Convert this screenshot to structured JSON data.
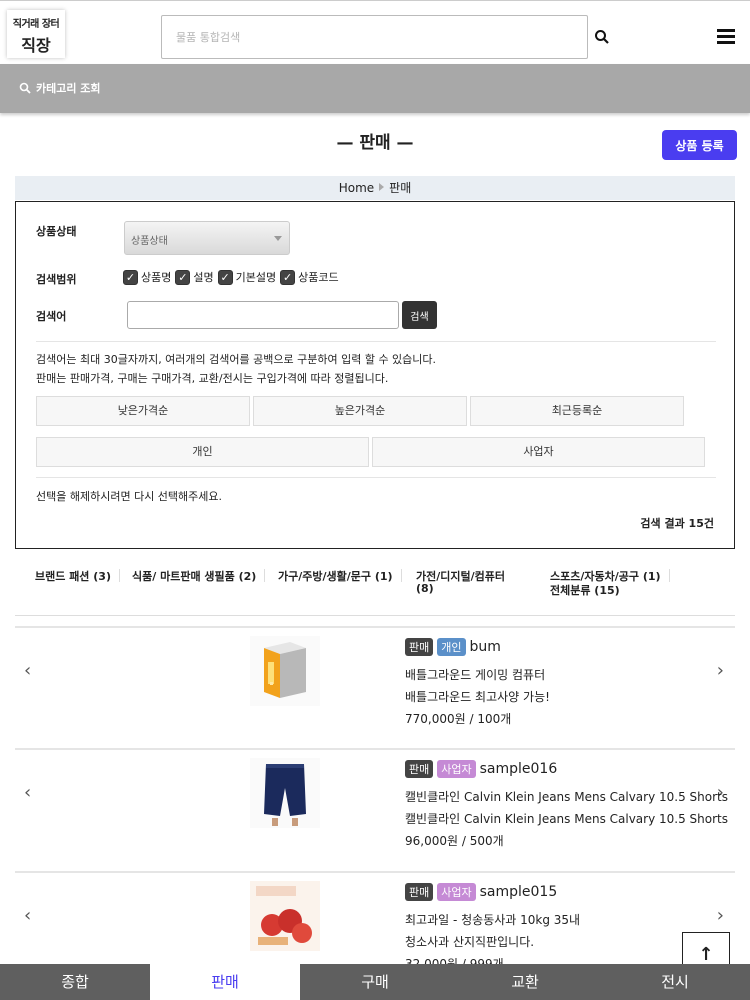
{
  "header": {
    "logo_line1": "직거래 장터",
    "logo_line2": "직장",
    "search_placeholder": "물품 통합검색"
  },
  "category_bar": {
    "label": "카테고리 조회"
  },
  "page_title": "— 판매 —",
  "register_button": "상품 등록",
  "breadcrumb": {
    "home": "Home",
    "current": "판매"
  },
  "filter": {
    "status_label": "상품상태",
    "status_select": "상품상태",
    "scope_label": "검색범위",
    "scope_options": [
      "상품명",
      "설명",
      "기본설명",
      "상품코드"
    ],
    "keyword_label": "검색어",
    "search_button": "검색",
    "note1": "검색어는 최대 30글자까지, 여러개의 검색어를 공백으로 구분하여 입력 할 수 있습니다.",
    "note2": "판매는 판매가격, 구매는 구매가격, 교환/전시는 구입가격에 따라 정렬됩니다.",
    "sort_buttons": [
      "낮은가격순",
      "높은가격순",
      "최근등록순"
    ],
    "type_buttons": [
      "개인",
      "사업자"
    ],
    "deselect_note": "선택을 해제하시려면 다시 선택해주세요.",
    "result_count": "검색 결과 15건"
  },
  "categories": [
    "브랜드 패션 (3)",
    "식품/ 마트판매 생필품 (2)",
    "가구/주방/생활/문구 (1)",
    "가전/디지털/컴퓨터",
    "(8)",
    "스포츠/자동차/공구 (1)",
    "전체분류 (15)"
  ],
  "products": [
    {
      "badge_type": "판매",
      "badge_owner": "개인",
      "seller": "bum",
      "name": "배틀그라운드 게이밍 컴퓨터",
      "desc": "배틀그라운드 최고사양 가능!",
      "price": "770,000원 / 100개"
    },
    {
      "badge_type": "판매",
      "badge_owner": "사업자",
      "seller": "sample016",
      "name": "캘빈클라인 Calvin Klein Jeans Mens Calvary 10.5 Shorts",
      "desc": "캘빈클라인 Calvin Klein Jeans Mens Calvary 10.5 Shorts",
      "price": "96,000원 / 500개"
    },
    {
      "badge_type": "판매",
      "badge_owner": "사업자",
      "seller": "sample015",
      "name": "최고과일 - 청송동사과 10kg 35내",
      "desc": "청소사과 산지직판입니다.",
      "price": "32,000원 / 999개"
    }
  ],
  "nav": {
    "prev": "‹",
    "next": "›"
  },
  "top_button": "↑",
  "tabs": [
    "종합",
    "판매",
    "구매",
    "교환",
    "전시"
  ],
  "colors": {
    "accent": "#4a3df0",
    "tab_bg": "#5f5f5f",
    "badge_sell": "#444444",
    "badge_individual": "#5b90c9",
    "badge_business": "#c58ad5"
  }
}
